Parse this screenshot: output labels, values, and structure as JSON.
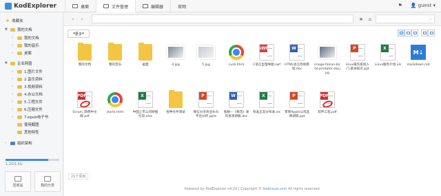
{
  "app": {
    "title": "KodExplorer"
  },
  "tabs": [
    {
      "label": "桌面"
    },
    {
      "label": "文件管理"
    },
    {
      "label": "编辑器"
    },
    {
      "label": "官网"
    }
  ],
  "topright": {
    "flag_icon": "flag-icon",
    "user_label": "guest"
  },
  "sidebar": {
    "favorites": "收藏夹",
    "my_docs": "我的文档",
    "my_docs_children": [
      "我的文档",
      "我的音乐",
      "桌面"
    ],
    "enterprise": "企业网盘",
    "enterprise_children": [
      "1.图片文件",
      "2.音乐资料",
      "3.视频资料",
      "4.办公文档",
      "5.工程文件",
      "6.压缩文件",
      "7.epub电子书",
      "使用截图",
      "其他特性"
    ],
    "org": "组织架构",
    "usage_text": "1.20/1.5G",
    "usage_fraction": 0.8,
    "recycle_label": "回收站",
    "share_label": "我的分享"
  },
  "address": {
    "path": "",
    "search_placeholder": ""
  },
  "toolbar": {
    "more_label": "更多"
  },
  "files": [
    {
      "name": "我的文档",
      "type": "folder"
    },
    {
      "name": "我的音乐",
      "type": "folder"
    },
    {
      "name": "桌面",
      "type": "folder"
    },
    {
      "name": "4.jpg",
      "type": "image",
      "color": "#7d8b98"
    },
    {
      "name": "5.jpg",
      "type": "image",
      "color": "#c7cbd2"
    },
    {
      "name": "curb.html",
      "type": "chrome"
    },
    {
      "name": "C语言哲理导图.swf",
      "type": "swf"
    },
    {
      "name": "HTML语言简易教程.doc",
      "type": "word"
    },
    {
      "name": "image-falcon-birds-predator-sky.jpg",
      "type": "image",
      "color": "#5f7080"
    },
    {
      "name": "linux操作系统入门-基本知识.ppt",
      "type": "ppt"
    },
    {
      "name": "Linux服务介绍.xls",
      "type": "excel"
    },
    {
      "name": "markdown.md",
      "type": "md"
    },
    {
      "name": "Scrum_简明中文版.pdf",
      "type": "pdf"
    },
    {
      "name": "starts.html",
      "type": "chrome"
    },
    {
      "name": "中国上市公司财报比较.xlsx",
      "type": "excel"
    },
    {
      "name": "各种文件测试",
      "type": "folder"
    },
    {
      "name": "微信分享商业头众平台分析.pptx",
      "type": "ppt"
    },
    {
      "name": "张静—《春花》发布会演讲稿.doc",
      "type": "word"
    },
    {
      "name": "标准正态分布表.xls",
      "type": "excel"
    },
    {
      "name": "苹果Apple公司品牌调研.ppt",
      "type": "ppt"
    },
    {
      "name": "软件工程.pdf",
      "type": "pdf"
    }
  ],
  "status": {
    "count": "21个项目"
  },
  "footer": {
    "left": "Powered by KodExplorer v4.24 | Copyright ©",
    "link": "kodcloud.com",
    "right": "All rights reserved."
  }
}
